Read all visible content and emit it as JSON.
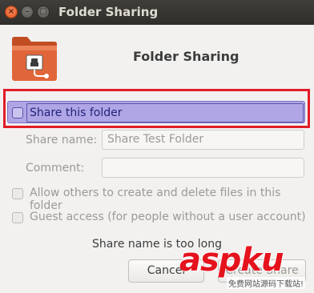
{
  "window": {
    "title": "Folder Sharing",
    "buttons": {
      "close": "×",
      "minimize": "–",
      "maximize": "□"
    }
  },
  "header": {
    "heading": "Folder Sharing",
    "icon": "folder-share-icon"
  },
  "share": {
    "label": "Share this folder",
    "checked": false
  },
  "form": {
    "share_name_label": "Share name:",
    "share_name_value": "Share Test Folder",
    "comment_label": "Comment:",
    "comment_value": ""
  },
  "options": {
    "allow_others": "Allow others to create and delete files in this folder",
    "guest_access": "Guest access (for people without a user account)"
  },
  "status": {
    "message": "Share name is too long"
  },
  "buttons": {
    "cancel": "Cancel",
    "create": "Create Share"
  },
  "watermark": {
    "brand": "aspku",
    "subtitle": "免费网站源码下载站!"
  },
  "colors": {
    "highlight_border": "#e11d28",
    "selection_fill": "#b0a6e6",
    "folder_orange": "#e0663a"
  }
}
